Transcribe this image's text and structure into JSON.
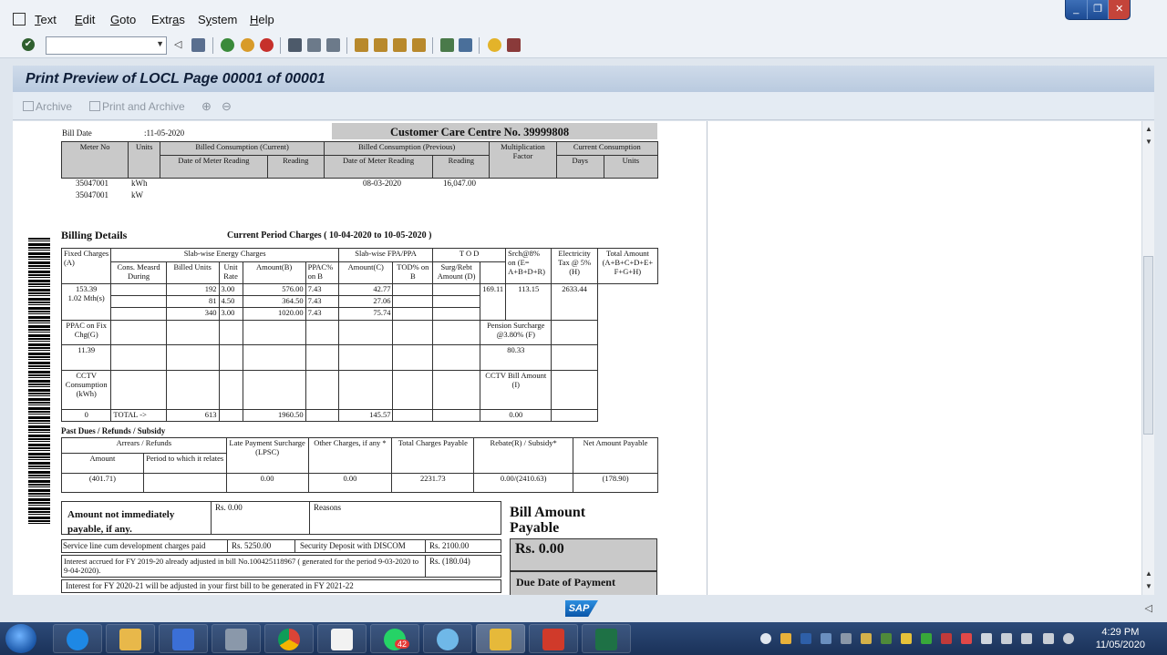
{
  "menu": {
    "items": [
      {
        "label": "Text",
        "underline": "T"
      },
      {
        "label": "Edit",
        "underline": "E"
      },
      {
        "label": "Goto",
        "underline": "G"
      },
      {
        "label": "Extras",
        "underline": "a"
      },
      {
        "label": "System",
        "underline": "y"
      },
      {
        "label": "Help",
        "underline": "H"
      }
    ]
  },
  "window_controls": {
    "minimize": "_",
    "restore": "❐",
    "close": "✕"
  },
  "toolbar": {
    "command_value": ""
  },
  "title": "Print Preview of LOCL Page 00001 of 00001",
  "app_toolbar": {
    "archive": "Archive",
    "print_and_archive": "Print and Archive",
    "zoom_in": "⊕",
    "zoom_out": "⊖"
  },
  "bill": {
    "bill_date_label": "Bill Date",
    "bill_date": ":11-05-2020",
    "ccc": "Customer Care Centre No.   39999808",
    "meter_table": {
      "meter_no": "Meter No",
      "units": "Units",
      "billed_current": "Billed Consumption (Current)",
      "billed_previous": "Billed Consumption (Previous)",
      "multiplication_factor": "Multiplication Factor",
      "current_consumption": "Current Consumption",
      "date_of_meter_reading": "Date of Meter Reading",
      "reading": "Reading",
      "days": "Days",
      "units2": "Units"
    },
    "meters": [
      {
        "no": "35047001",
        "unit": "kWh",
        "prev_date": "08-03-2020",
        "prev_reading": "16,047.00"
      },
      {
        "no": "35047001",
        "unit": "kW",
        "prev_date": "",
        "prev_reading": ""
      }
    ],
    "billing_details": "Billing Details",
    "current_period": "Current Period Charges (    10-04-2020   to   10-05-2020   )",
    "charges": {
      "fixed": "Fixed Charges (A)",
      "slab_energy": "Slab-wise Energy Charges",
      "slab_fpa": "Slab-wise FPA/PPA",
      "tod": "T O D",
      "srch": "Srch@8% on (E= A+B+D+R)",
      "elec_tax": "Electricity Tax  @ 5% (H)",
      "total_amount": "Total Amount (A+B+C+D+E+ F+G+H)",
      "cons_measrd": "Cons. Measrd During",
      "billed_units": "Billed Units",
      "unit_rate": "Unit Rate",
      "amount_b": "Amount(B)",
      "ppac": "PPAC% on B",
      "amount_c": "Amount(C)",
      "tod_pct": "TOD% on B",
      "surg": "Surg/Rebt Amount (D)",
      "fixed_val": "153.39",
      "fixed_sub": "1.02 Mth(s)",
      "rows": [
        {
          "units": "192",
          "rate": "3.00",
          "amt_b": "576.00",
          "ppac": "7.43",
          "amt_c": "42.77"
        },
        {
          "units": "81",
          "rate": "4.50",
          "amt_b": "364.50",
          "ppac": "7.43",
          "amt_c": "27.06"
        },
        {
          "units": "340",
          "rate": "3.00",
          "amt_b": "1020.00",
          "ppac": "7.43",
          "amt_c": "75.74"
        }
      ],
      "srch_val": "169.11",
      "tax_val": "113.15",
      "total_val": "2633.44",
      "ppac_fix": "PPAC on Fix Chg(G)",
      "ppac_fix_val": "11.39",
      "pension": "Pension Surcharge @3.80% (F)",
      "pension_val": "80.33",
      "cctv": "CCTV Consumption (kWh)",
      "cctv_val": "0",
      "cctv_bill": "CCTV Bill Amount (I)",
      "cctv_bill_val": "0.00",
      "total_label": "TOTAL ->",
      "total_units": "613",
      "total_b": "1960.50",
      "total_c": "145.57"
    },
    "past_dues": {
      "title": "Past Dues / Refunds / Subsidy",
      "arrears": "Arrears / Refunds",
      "lpsc": "Late Payment Surcharge (LPSC)",
      "other": "Other Charges, if any *",
      "total_payable": "Total  Charges Payable",
      "rebate": "Rebate(R) / Subsidy*",
      "net_payable": "Net Amount Payable",
      "amount": "Amount",
      "period": "Period to which it relates",
      "amount_val": "(401.71)",
      "lpsc_val": "0.00",
      "other_val": "0.00",
      "total_val": "2231.73",
      "rebate_val": "0.00/(2410.63)",
      "net_val": "(178.90)"
    },
    "not_payable": "Amount not immediately payable, if any.",
    "not_payable_rs": "Rs. 0.00",
    "reasons": "Reasons",
    "service_line": "Service line cum development charges paid",
    "service_line_val": "Rs. 5250.00",
    "security_deposit": "Security Deposit with DISCOM",
    "security_deposit_val": "Rs.  2100.00",
    "interest_note": "Interest accrued for FY 2019-20 already adjusted in bill No.100425118967 ( generated for the period  9-03-2020 to 9-04-2020).",
    "interest_val": "Rs.  (180.04)",
    "interest_note2": "Interest  for FY  2020-21 will  be adjusted  in your first bill  to be generated in  FY 2021-22",
    "bill_amount_payable": "Bill Amount Payable",
    "bill_amount": "Rs. 0.00",
    "due_date": "Due Date of Payment"
  },
  "status": {
    "logo": "SAP"
  },
  "taskbar": {
    "whatsapp_badge": "42",
    "time": "4:29 PM",
    "date": "11/05/2020"
  }
}
